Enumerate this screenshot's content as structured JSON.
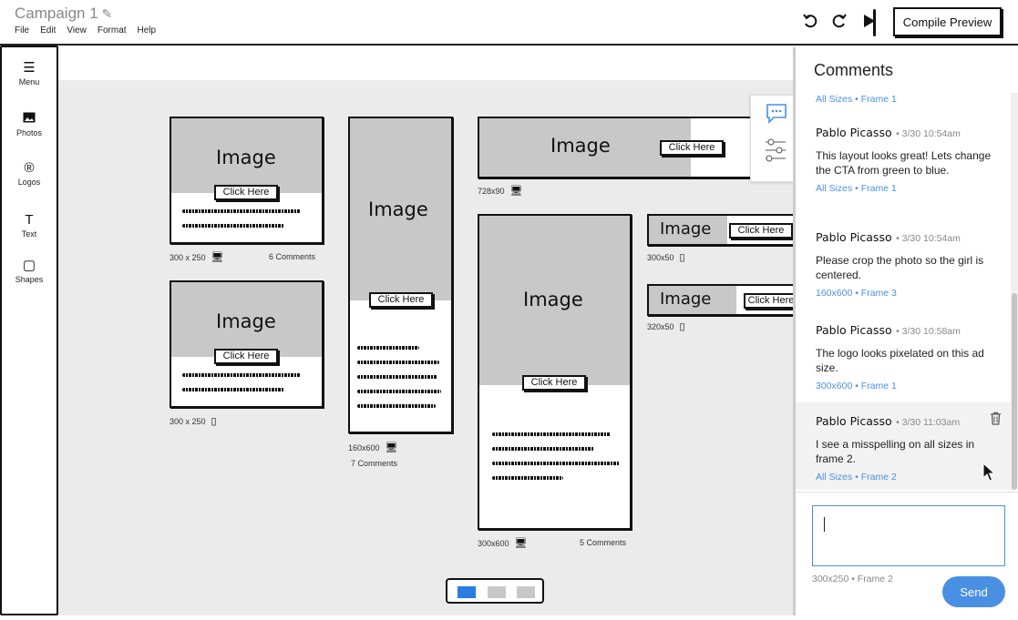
{
  "header": {
    "title": "Campaign 1",
    "menu": [
      "File",
      "Edit",
      "View",
      "Format",
      "Help"
    ],
    "compile_label": "Compile Preview",
    "icons": [
      "undo-icon",
      "redo-icon",
      "play-icon"
    ]
  },
  "rail": {
    "items": [
      {
        "label": "Menu",
        "icon": "hamburger-icon"
      },
      {
        "label": "Photos",
        "icon": "photo-icon"
      },
      {
        "label": "Logos",
        "icon": "registered-icon"
      },
      {
        "label": "Text",
        "icon": "text-icon"
      },
      {
        "label": "Shapes",
        "icon": "square-icon"
      }
    ]
  },
  "ads": {
    "image_label": "Image",
    "cta_label": "Click Here",
    "a300x250_desktop": {
      "size": "300 x 250",
      "comments": "6 Comments"
    },
    "a300x250_mobile": {
      "size": "300 x 250"
    },
    "a160x600": {
      "size": "160x600",
      "comments": "7 Comments"
    },
    "a728x90": {
      "size": "728x90"
    },
    "a300x600": {
      "size": "300x600",
      "comments": "5 Comments"
    },
    "a300x50": {
      "size": "300x50"
    },
    "a320x50": {
      "size": "320x50"
    }
  },
  "pager": {
    "active": 0,
    "count": 3
  },
  "colors": {
    "accent": "#4a90e2",
    "pager_active": "#2a7de1",
    "image_fill": "#c8c8c8"
  },
  "comments": {
    "title": "Comments",
    "partial_tag": "All Sizes • Frame 1",
    "items": [
      {
        "author": "Pablo Picasso",
        "stamp": "• 3/30 10:54am",
        "body": "This layout looks great! Lets change the CTA from green to blue.",
        "tag": "All Sizes • Frame 1"
      },
      {
        "author": "Pablo Picasso",
        "stamp": "• 3/30 10:54am",
        "body": "Please crop the photo so the girl is centered.",
        "tag": "160x600 • Frame 3"
      },
      {
        "author": "Pablo Picasso",
        "stamp": "• 3/30 10:58am",
        "body": "The logo looks pixelated on this ad size.",
        "tag": "300x600 • Frame 1"
      },
      {
        "author": "Pablo Picasso",
        "stamp": "• 3/30 11:03am",
        "body": "I see a misspelling on all sizes in frame 2.",
        "tag": "All Sizes • Frame 2"
      }
    ],
    "input_value": "",
    "reply_ref": "300x250 • Frame 2",
    "send_label": "Send"
  }
}
